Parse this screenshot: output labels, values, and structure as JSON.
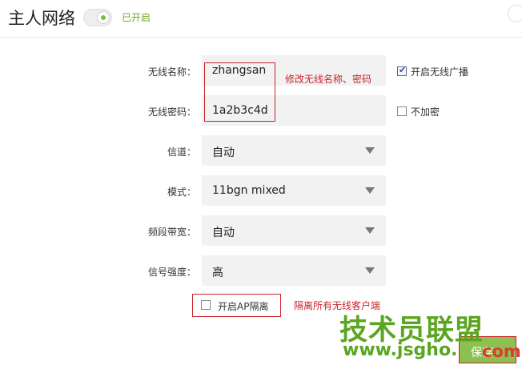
{
  "header": {
    "title": "主人网络",
    "status": "已开启"
  },
  "form": {
    "ssid": {
      "label": "无线名称：",
      "value": "zhangsan"
    },
    "password": {
      "label": "无线密码：",
      "value": "1a2b3c4d"
    },
    "channel": {
      "label": "信道：",
      "value": "自动"
    },
    "mode": {
      "label": "模式：",
      "value": "11bgn mixed"
    },
    "bandwidth": {
      "label": "频段带宽：",
      "value": "自动"
    },
    "power": {
      "label": "信号强度：",
      "value": "高"
    },
    "broadcast": {
      "label": "开启无线广播",
      "checked": true
    },
    "no_encrypt": {
      "label": "不加密",
      "checked": false
    },
    "ap_isolation": {
      "label": "开启AP隔离",
      "checked": false
    }
  },
  "annotations": {
    "ssid_note": "修改无线名称、密码",
    "ap_note": "隔离所有无线客户端"
  },
  "actions": {
    "save_label": "保存"
  },
  "watermark": {
    "text_cn": "技术员联盟",
    "url": "www.jsgho.",
    "url_tld": "com"
  },
  "colors": {
    "accent_green": "#8cc152",
    "annotation_red": "#c9242b",
    "toggle_dot": "#7bbf3f"
  }
}
